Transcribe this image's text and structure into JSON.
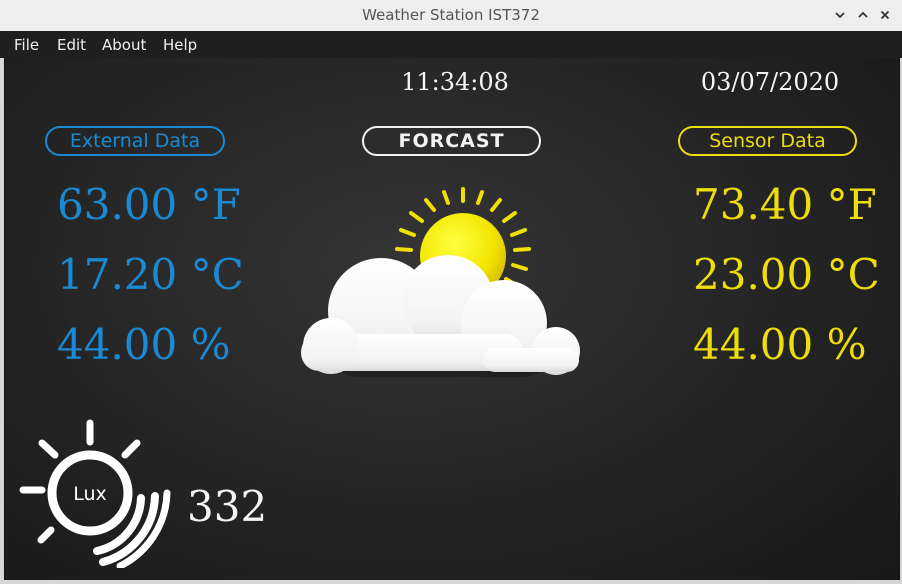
{
  "window": {
    "title": "Weather Station IST372"
  },
  "menu": {
    "items": [
      "File",
      "Edit",
      "About",
      "Help"
    ]
  },
  "clock": {
    "time": "11:34:08",
    "date": "03/07/2020"
  },
  "external": {
    "label": "External Data",
    "temp_f": "63.00 °F",
    "temp_c": "17.20 °C",
    "humidity": "44.00 %",
    "color": "#1a8ad4"
  },
  "forecast": {
    "label": "FORCAST",
    "icon": "partly-cloudy-icon"
  },
  "sensor": {
    "label": "Sensor Data",
    "temp_f": "73.40 °F",
    "temp_c": "23.00 °C",
    "humidity": "44.00 %",
    "color": "#eedd0a"
  },
  "light": {
    "icon_label": "Lux",
    "value": "332"
  }
}
